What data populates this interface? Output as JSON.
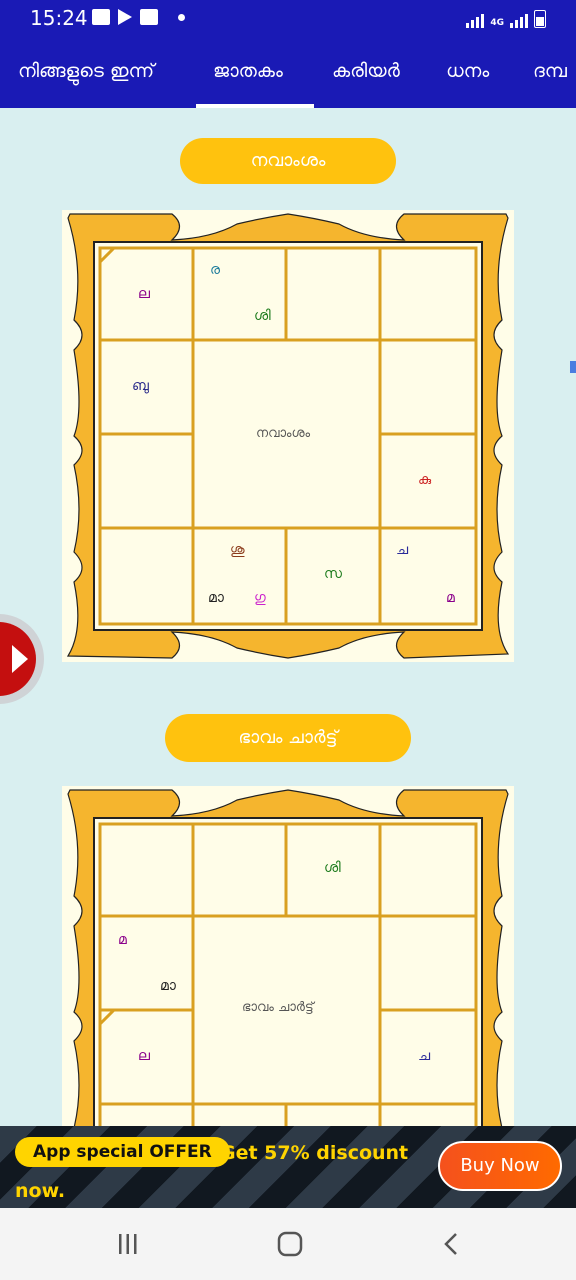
{
  "status_bar": {
    "time": "15:24",
    "network": "4G"
  },
  "tabs": [
    {
      "label": "നിങ്ങളുടെ ഇന്ന്",
      "selected": false
    },
    {
      "label": "ജാതകം",
      "selected": true
    },
    {
      "label": "കരിയർ",
      "selected": false
    },
    {
      "label": "ധനം",
      "selected": false
    },
    {
      "label": "ദമ്പ",
      "selected": false
    }
  ],
  "charts": [
    {
      "heading": "നവാംശം",
      "center_label": "നവാംശം",
      "cells": [
        {
          "text": "ല",
          "color": "#8b008b"
        },
        {
          "text": "ര",
          "color": "#1a7a9a"
        },
        {
          "text": "ശി",
          "color": "#1a7a1a"
        },
        {
          "text": "ബു",
          "color": "#2a2a8a"
        },
        {
          "text": "കു",
          "color": "#cc2222"
        },
        {
          "text": "ശു",
          "color": "#8b3a1a"
        },
        {
          "text": "മാ",
          "color": "#222222"
        },
        {
          "text": "ഗു",
          "color": "#cc22cc"
        },
        {
          "text": "സ",
          "color": "#1a7a1a"
        },
        {
          "text": "ച",
          "color": "#2a2a9a"
        },
        {
          "text": "മ",
          "color": "#8b008b"
        }
      ]
    },
    {
      "heading": "ഭാവം ചാർട്ട്",
      "center_label": "ഭാവം ചാർട്ട്",
      "cells": [
        {
          "text": "ശി",
          "color": "#1a7a1a"
        },
        {
          "text": "മ",
          "color": "#8b008b"
        },
        {
          "text": "മാ",
          "color": "#222222"
        },
        {
          "text": "ല",
          "color": "#8b008b"
        },
        {
          "text": "ച",
          "color": "#2a2a9a"
        }
      ]
    }
  ],
  "banner": {
    "offer_label": "App special OFFER",
    "discount_text": "Get 57% discount",
    "discount_text_line2": "now.",
    "buy_label": "Buy Now"
  },
  "colors": {
    "app_bar": "#1a1ab5",
    "accent_yellow": "#ffc20e",
    "chart_gold": "#f5b52e",
    "chart_bg": "#fffde8",
    "page_bg": "#d9eff0"
  }
}
